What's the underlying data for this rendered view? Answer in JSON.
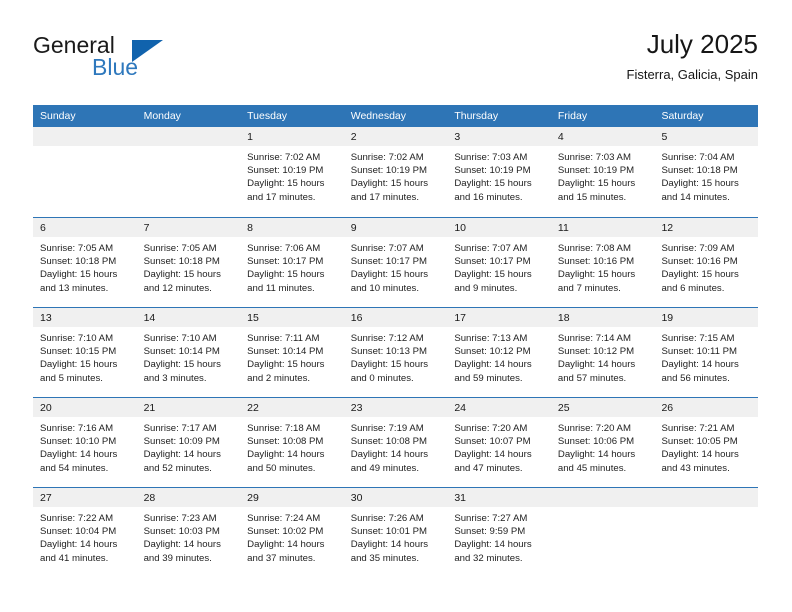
{
  "brand": {
    "name_part1": "General",
    "name_part2": "Blue",
    "logo_icon": "triangle-logo-icon"
  },
  "header": {
    "title": "July 2025",
    "subtitle": "Fisterra, Galicia, Spain"
  },
  "colors": {
    "header_blue": "#2E75B6",
    "brand_blue": "#2E78BD",
    "logo_blue": "#1163AD",
    "day_band_gray": "#F0F0F0",
    "text": "#1A1A1A"
  },
  "calendar": {
    "weekdays": [
      "Sunday",
      "Monday",
      "Tuesday",
      "Wednesday",
      "Thursday",
      "Friday",
      "Saturday"
    ],
    "weeks": [
      [
        {
          "day": "",
          "lines": []
        },
        {
          "day": "",
          "lines": []
        },
        {
          "day": "1",
          "lines": [
            "Sunrise: 7:02 AM",
            "Sunset: 10:19 PM",
            "Daylight: 15 hours",
            "and 17 minutes."
          ]
        },
        {
          "day": "2",
          "lines": [
            "Sunrise: 7:02 AM",
            "Sunset: 10:19 PM",
            "Daylight: 15 hours",
            "and 17 minutes."
          ]
        },
        {
          "day": "3",
          "lines": [
            "Sunrise: 7:03 AM",
            "Sunset: 10:19 PM",
            "Daylight: 15 hours",
            "and 16 minutes."
          ]
        },
        {
          "day": "4",
          "lines": [
            "Sunrise: 7:03 AM",
            "Sunset: 10:19 PM",
            "Daylight: 15 hours",
            "and 15 minutes."
          ]
        },
        {
          "day": "5",
          "lines": [
            "Sunrise: 7:04 AM",
            "Sunset: 10:18 PM",
            "Daylight: 15 hours",
            "and 14 minutes."
          ]
        }
      ],
      [
        {
          "day": "6",
          "lines": [
            "Sunrise: 7:05 AM",
            "Sunset: 10:18 PM",
            "Daylight: 15 hours",
            "and 13 minutes."
          ]
        },
        {
          "day": "7",
          "lines": [
            "Sunrise: 7:05 AM",
            "Sunset: 10:18 PM",
            "Daylight: 15 hours",
            "and 12 minutes."
          ]
        },
        {
          "day": "8",
          "lines": [
            "Sunrise: 7:06 AM",
            "Sunset: 10:17 PM",
            "Daylight: 15 hours",
            "and 11 minutes."
          ]
        },
        {
          "day": "9",
          "lines": [
            "Sunrise: 7:07 AM",
            "Sunset: 10:17 PM",
            "Daylight: 15 hours",
            "and 10 minutes."
          ]
        },
        {
          "day": "10",
          "lines": [
            "Sunrise: 7:07 AM",
            "Sunset: 10:17 PM",
            "Daylight: 15 hours",
            "and 9 minutes."
          ]
        },
        {
          "day": "11",
          "lines": [
            "Sunrise: 7:08 AM",
            "Sunset: 10:16 PM",
            "Daylight: 15 hours",
            "and 7 minutes."
          ]
        },
        {
          "day": "12",
          "lines": [
            "Sunrise: 7:09 AM",
            "Sunset: 10:16 PM",
            "Daylight: 15 hours",
            "and 6 minutes."
          ]
        }
      ],
      [
        {
          "day": "13",
          "lines": [
            "Sunrise: 7:10 AM",
            "Sunset: 10:15 PM",
            "Daylight: 15 hours",
            "and 5 minutes."
          ]
        },
        {
          "day": "14",
          "lines": [
            "Sunrise: 7:10 AM",
            "Sunset: 10:14 PM",
            "Daylight: 15 hours",
            "and 3 minutes."
          ]
        },
        {
          "day": "15",
          "lines": [
            "Sunrise: 7:11 AM",
            "Sunset: 10:14 PM",
            "Daylight: 15 hours",
            "and 2 minutes."
          ]
        },
        {
          "day": "16",
          "lines": [
            "Sunrise: 7:12 AM",
            "Sunset: 10:13 PM",
            "Daylight: 15 hours",
            "and 0 minutes."
          ]
        },
        {
          "day": "17",
          "lines": [
            "Sunrise: 7:13 AM",
            "Sunset: 10:12 PM",
            "Daylight: 14 hours",
            "and 59 minutes."
          ]
        },
        {
          "day": "18",
          "lines": [
            "Sunrise: 7:14 AM",
            "Sunset: 10:12 PM",
            "Daylight: 14 hours",
            "and 57 minutes."
          ]
        },
        {
          "day": "19",
          "lines": [
            "Sunrise: 7:15 AM",
            "Sunset: 10:11 PM",
            "Daylight: 14 hours",
            "and 56 minutes."
          ]
        }
      ],
      [
        {
          "day": "20",
          "lines": [
            "Sunrise: 7:16 AM",
            "Sunset: 10:10 PM",
            "Daylight: 14 hours",
            "and 54 minutes."
          ]
        },
        {
          "day": "21",
          "lines": [
            "Sunrise: 7:17 AM",
            "Sunset: 10:09 PM",
            "Daylight: 14 hours",
            "and 52 minutes."
          ]
        },
        {
          "day": "22",
          "lines": [
            "Sunrise: 7:18 AM",
            "Sunset: 10:08 PM",
            "Daylight: 14 hours",
            "and 50 minutes."
          ]
        },
        {
          "day": "23",
          "lines": [
            "Sunrise: 7:19 AM",
            "Sunset: 10:08 PM",
            "Daylight: 14 hours",
            "and 49 minutes."
          ]
        },
        {
          "day": "24",
          "lines": [
            "Sunrise: 7:20 AM",
            "Sunset: 10:07 PM",
            "Daylight: 14 hours",
            "and 47 minutes."
          ]
        },
        {
          "day": "25",
          "lines": [
            "Sunrise: 7:20 AM",
            "Sunset: 10:06 PM",
            "Daylight: 14 hours",
            "and 45 minutes."
          ]
        },
        {
          "day": "26",
          "lines": [
            "Sunrise: 7:21 AM",
            "Sunset: 10:05 PM",
            "Daylight: 14 hours",
            "and 43 minutes."
          ]
        }
      ],
      [
        {
          "day": "27",
          "lines": [
            "Sunrise: 7:22 AM",
            "Sunset: 10:04 PM",
            "Daylight: 14 hours",
            "and 41 minutes."
          ]
        },
        {
          "day": "28",
          "lines": [
            "Sunrise: 7:23 AM",
            "Sunset: 10:03 PM",
            "Daylight: 14 hours",
            "and 39 minutes."
          ]
        },
        {
          "day": "29",
          "lines": [
            "Sunrise: 7:24 AM",
            "Sunset: 10:02 PM",
            "Daylight: 14 hours",
            "and 37 minutes."
          ]
        },
        {
          "day": "30",
          "lines": [
            "Sunrise: 7:26 AM",
            "Sunset: 10:01 PM",
            "Daylight: 14 hours",
            "and 35 minutes."
          ]
        },
        {
          "day": "31",
          "lines": [
            "Sunrise: 7:27 AM",
            "Sunset: 9:59 PM",
            "Daylight: 14 hours",
            "and 32 minutes."
          ]
        },
        {
          "day": "",
          "lines": []
        },
        {
          "day": "",
          "lines": []
        }
      ]
    ]
  }
}
